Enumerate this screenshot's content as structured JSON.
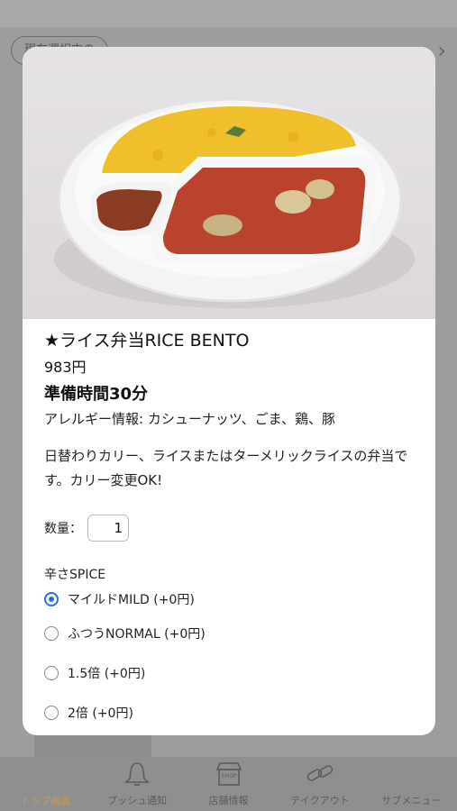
{
  "background": {
    "chip_label": "現在選択中の",
    "arrow": "›"
  },
  "modal": {
    "title": "★ライス弁当RICE BENTO",
    "price": "983円",
    "prep_time": "準備時間30分",
    "allergy": "アレルギー情報: カシューナッツ、ごま、鶏、豚",
    "description": "日替わりカリー、ライスまたはターメリックライスの弁当です。カリー変更OK!",
    "quantity_label": "数量：",
    "quantity_value": "1",
    "spice_label": "辛さSPICE",
    "spice_options": [
      {
        "label": "マイルドMILD (+0円)",
        "selected": true
      },
      {
        "label": "ふつうNORMAL (+0円)",
        "selected": false
      },
      {
        "label": "1.5倍 (+0円)",
        "selected": false
      },
      {
        "label": "2倍 (+0円)",
        "selected": false
      }
    ]
  },
  "tabbar": {
    "items": [
      {
        "label": "トップ画面",
        "icon": "home-icon",
        "active": true
      },
      {
        "label": "プッシュ通知",
        "icon": "bell-icon",
        "active": false
      },
      {
        "label": "店舗情報",
        "icon": "shop-icon",
        "active": false
      },
      {
        "label": "テイクアウト",
        "icon": "link-icon",
        "active": false
      },
      {
        "label": "サブメニュー",
        "icon": "menu-icon",
        "active": false
      }
    ],
    "shop_icon_text": "SHOP"
  },
  "colors": {
    "accent_radio": "#2a6edc",
    "active_tab": "#c89a5a"
  }
}
